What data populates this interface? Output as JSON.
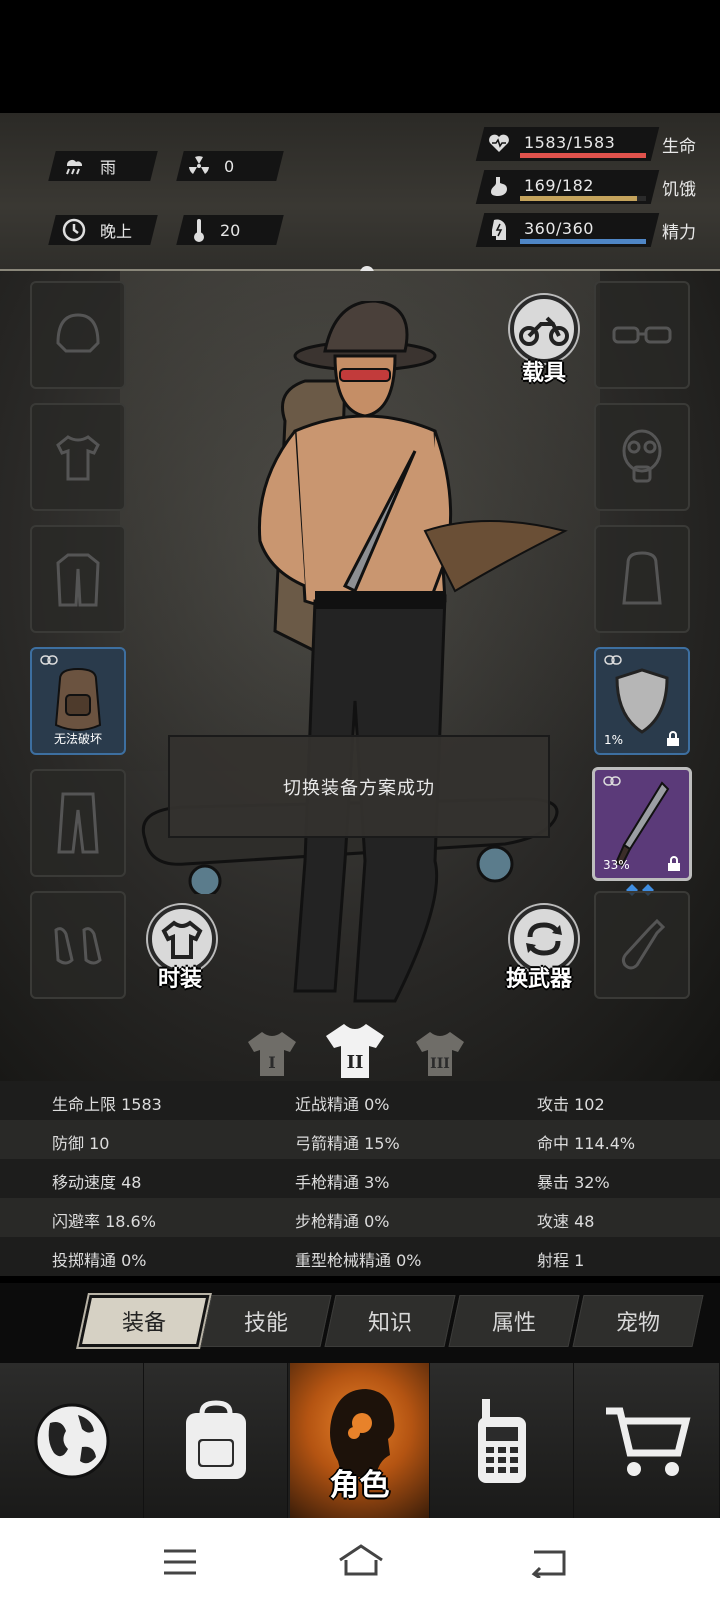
{
  "status": {
    "weather": "雨",
    "radiation": "0",
    "time_of_day": "晚上",
    "temperature": "20",
    "bars": [
      {
        "icon": "heart-icon",
        "value": "1583/1583",
        "label": "生命",
        "fraction": 1.0,
        "color": "#e0524c"
      },
      {
        "icon": "stomach-icon",
        "value": "169/182",
        "label": "饥饿",
        "fraction": 0.93,
        "color": "#c4a35c"
      },
      {
        "icon": "energy-icon",
        "value": "360/360",
        "label": "精力",
        "fraction": 1.0,
        "color": "#4f86c6"
      }
    ]
  },
  "equipment": {
    "vehicle_label": "载具",
    "fashion_label": "时装",
    "switch_weapon_label": "换武器",
    "backpack_caption": "无法破坏",
    "shield_durability": "1%",
    "machete_durability": "33%",
    "toast": "切换装备方案成功",
    "outfit_sets": [
      "I",
      "II",
      "III"
    ]
  },
  "stats": [
    [
      "生命上限 1583",
      "近战精通 0%",
      "攻击 102"
    ],
    [
      "防御 10",
      "弓箭精通 15%",
      "命中 114.4%"
    ],
    [
      "移动速度 48",
      "手枪精通 3%",
      "暴击 32%"
    ],
    [
      "闪避率 18.6%",
      "步枪精通 0%",
      "攻速 48"
    ],
    [
      "投掷精通 0%",
      "重型枪械精通 0%",
      "射程 1"
    ]
  ],
  "tabs": [
    "装备",
    "技能",
    "知识",
    "属性",
    "宠物"
  ],
  "nav": {
    "active_label": "角色"
  }
}
